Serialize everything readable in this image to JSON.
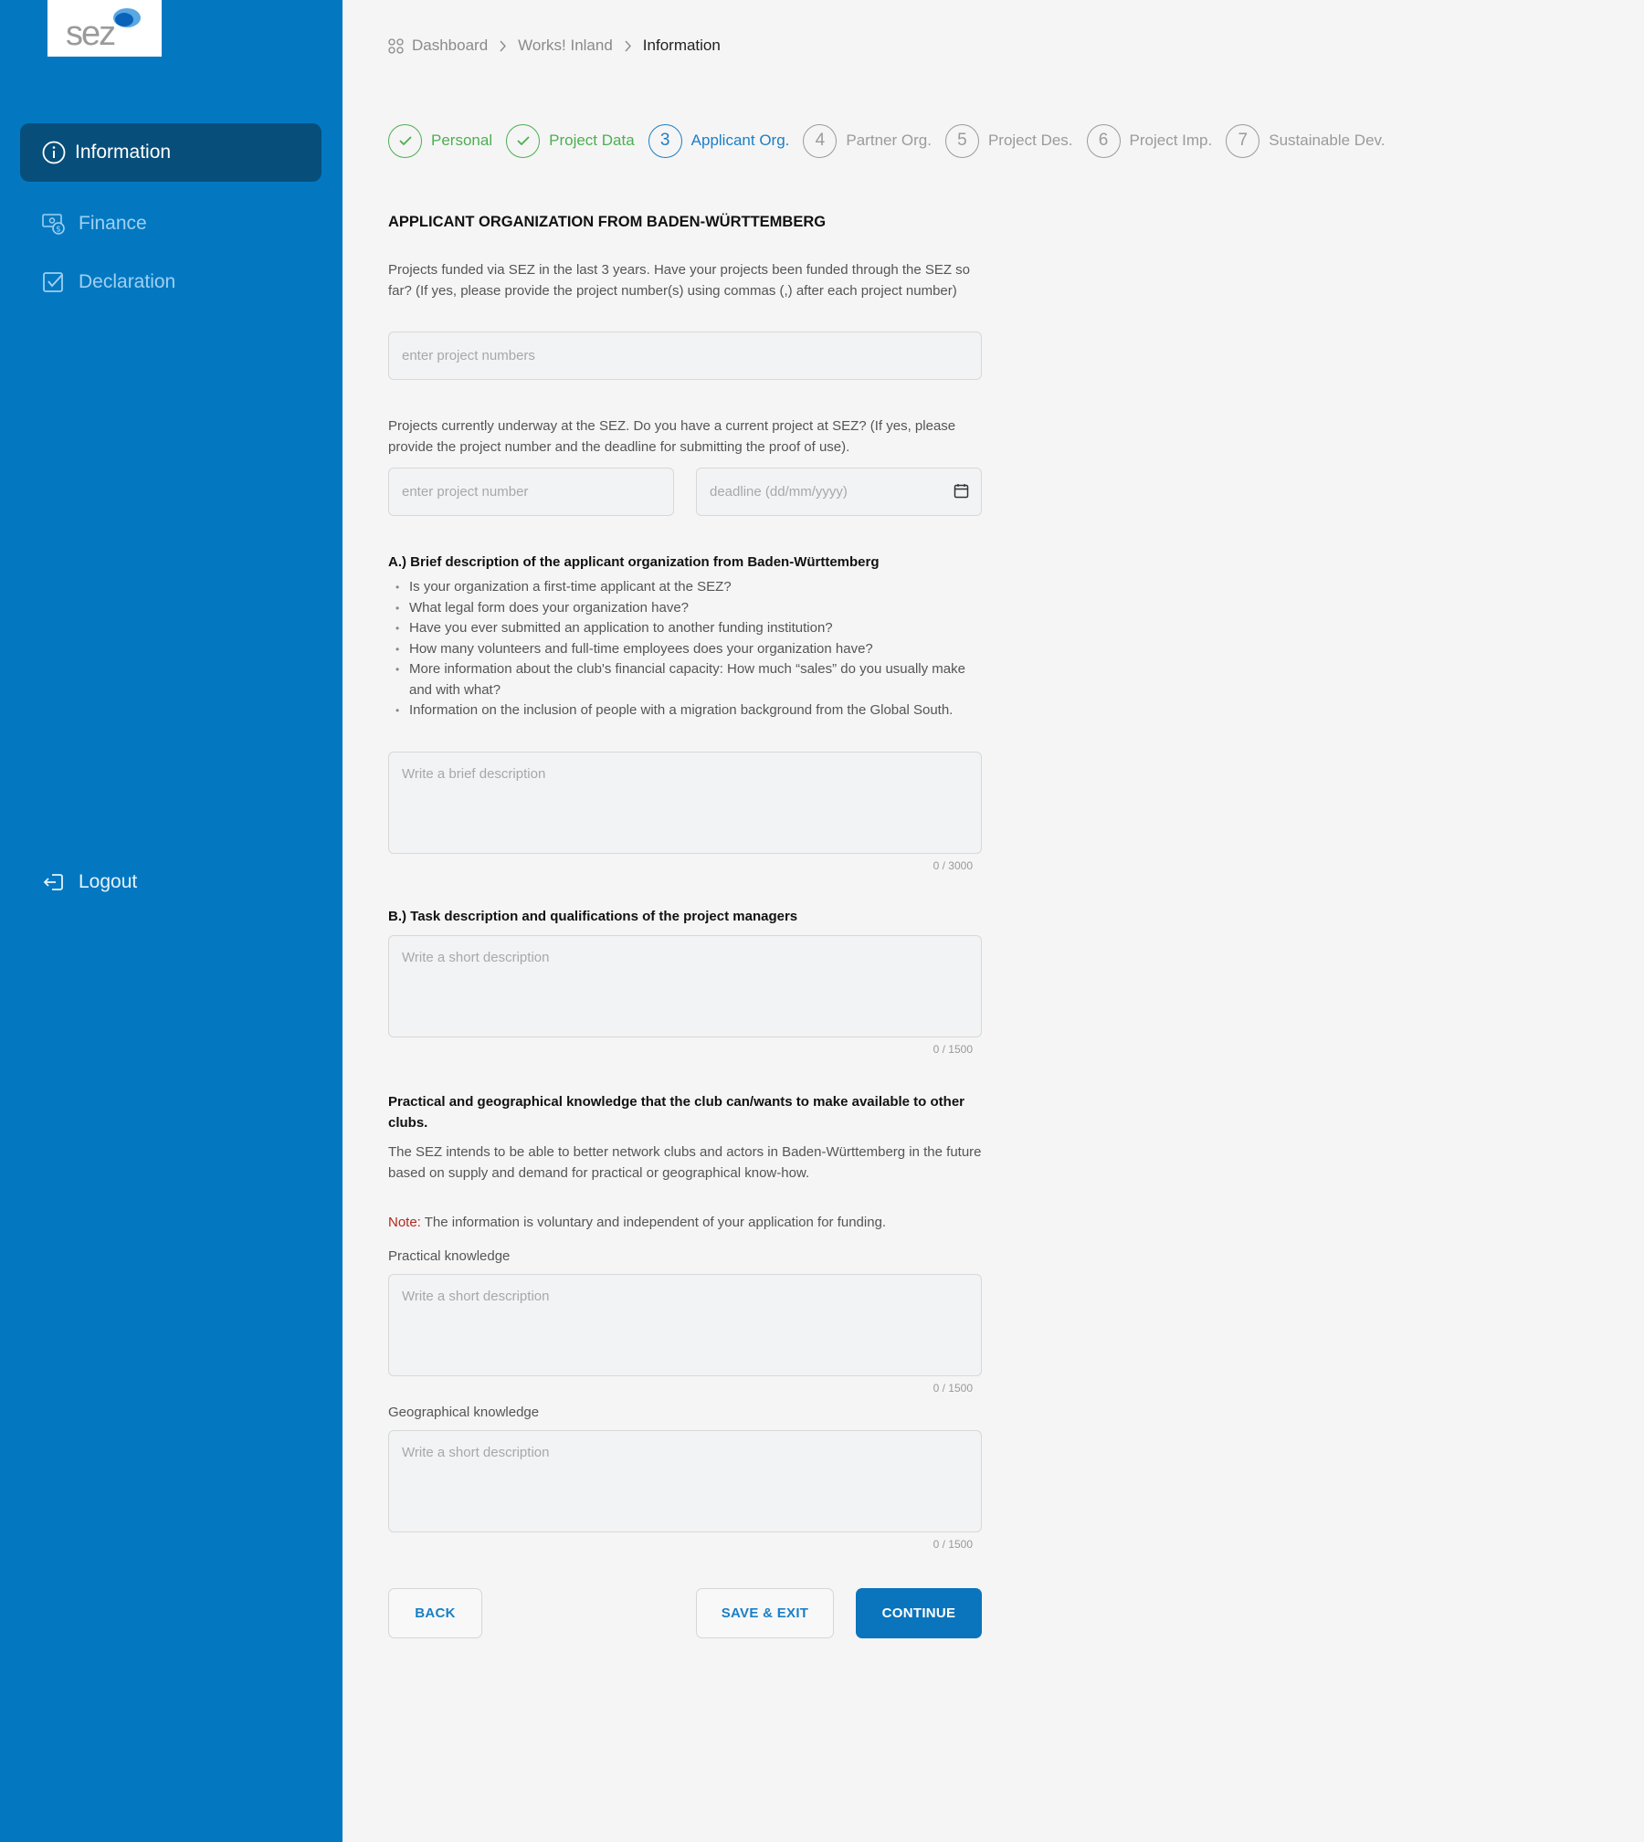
{
  "brand": {
    "logo_text": "sez",
    "accent": "#0378c1",
    "active_nav": "#074e7b"
  },
  "sidebar": {
    "items": [
      {
        "label": "Information",
        "icon": "info-icon",
        "active": true
      },
      {
        "label": "Finance",
        "icon": "finance-icon",
        "active": false
      },
      {
        "label": "Declaration",
        "icon": "checkbox-icon",
        "active": false
      }
    ],
    "logout_label": "Logout"
  },
  "breadcrumb": {
    "items": [
      "Dashboard",
      "Works! Inland",
      "Information"
    ]
  },
  "stepper": {
    "steps": [
      {
        "number": "1",
        "label": "Personal",
        "state": "done"
      },
      {
        "number": "2",
        "label": "Project Data",
        "state": "done"
      },
      {
        "number": "3",
        "label": "Applicant Org.",
        "state": "current"
      },
      {
        "number": "4",
        "label": "Partner Org.",
        "state": "upcoming"
      },
      {
        "number": "5",
        "label": "Project Des.",
        "state": "upcoming"
      },
      {
        "number": "6",
        "label": "Project Imp.",
        "state": "upcoming"
      },
      {
        "number": "7",
        "label": "Sustainable Dev.",
        "state": "upcoming"
      }
    ]
  },
  "form": {
    "title": "APPLICANT ORGANIZATION FROM BADEN-WÜRTTEMBERG",
    "funded": {
      "text": "Projects funded via SEZ in the last 3 years. Have your projects been funded through the SEZ so far? (If yes, please provide the project number(s) using commas (,) after each project number)",
      "placeholder": "enter project numbers",
      "value": ""
    },
    "underway": {
      "text": "Projects currently underway at the SEZ. Do you have a current project at SEZ? (If yes, please provide the project number and the deadline for submitting the proof of use).",
      "number_placeholder": "enter project number",
      "deadline_placeholder": "deadline (dd/mm/yyyy)"
    },
    "section_a": {
      "heading": "A.) Brief description of the applicant organization from Baden-Württemberg",
      "bullets": [
        "Is your organization a first-time applicant at the SEZ?",
        "What legal form does your organization have?",
        "Have you ever submitted an application to another funding institution?",
        "How many volunteers and full-time employees does your organization have?",
        "More information about the club's financial capacity: How much “sales” do you usually make and with what?",
        "Information on the inclusion of people with a migration background from the Global South."
      ],
      "placeholder": "Write a brief description",
      "counter": "0 / 3000"
    },
    "section_b": {
      "heading": "B.) Task description and qualifications of the project managers",
      "placeholder": "Write a short description",
      "counter": "0 / 1500"
    },
    "knowledge": {
      "heading": "Practical and geographical knowledge that the club can/wants to make available to other clubs.",
      "text": "The SEZ intends to be able to better network clubs and actors in Baden-Württemberg in the future based on supply and demand for practical or geographical know-how.",
      "note_label": "Note:",
      "note_text": " The information is voluntary and independent of your application for funding.",
      "practical_label": "Practical knowledge",
      "practical_placeholder": "Write a short description",
      "practical_counter": "0 / 1500",
      "geo_label": "Geographical knowledge",
      "geo_placeholder": "Write a short description",
      "geo_counter": "0 / 1500"
    }
  },
  "buttons": {
    "back": "BACK",
    "save_exit": "SAVE & EXIT",
    "continue": "CONTINUE"
  }
}
